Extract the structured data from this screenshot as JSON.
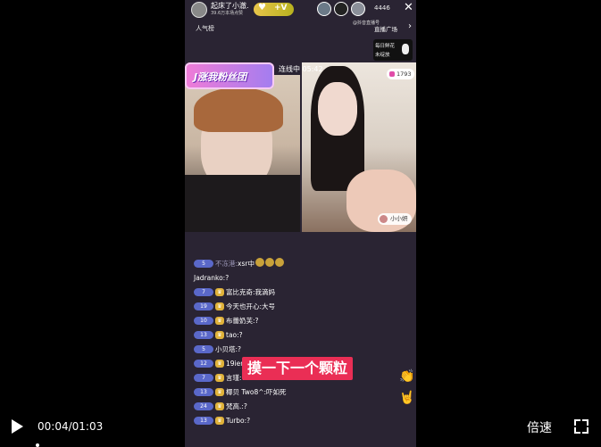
{
  "host": {
    "name": "起床了小澈.",
    "sub": "39.6万本场点赞",
    "follow_icon": "heart-icon",
    "follow_label": "+V",
    "viewer_count": "4446",
    "close_symbol": "✕"
  },
  "top": {
    "popular_label": "人气榜",
    "watermark": "@抖音直播号",
    "plaza_label": "直播广场",
    "plaza_arrow": "›",
    "gift_line1": "每日鲜花",
    "gift_line2": "未绽放"
  },
  "pk": {
    "banner_label": "J涨我粉丝团",
    "status_label": "连线中 05:42",
    "right_badge_count": "1793",
    "right_name": "小小妍"
  },
  "chat": [
    {
      "level": "5",
      "name": "不冻港:",
      "text": "xsr中",
      "muted": true,
      "emoji": 3
    },
    {
      "level": "",
      "name": "Jadranko:",
      "text": "?"
    },
    {
      "level": "7",
      "name": "富比克奇:",
      "text": "我滴妈"
    },
    {
      "level": "19",
      "name": "今天也开心:",
      "text": "大号"
    },
    {
      "level": "10",
      "name": "布蕾奶芙:",
      "text": "?"
    },
    {
      "level": "13",
      "name": "tao:",
      "text": "?"
    },
    {
      "level": "5",
      "name": "小贝塔:",
      "text": "?"
    },
    {
      "level": "12",
      "name": "19ien",
      "text": ""
    },
    {
      "level": "7",
      "name": "言瑾:",
      "text": "?"
    },
    {
      "level": "13",
      "name": "椰贝 Two8^:",
      "text": "吓如死"
    },
    {
      "level": "24",
      "name": "梵高.:",
      "text": "?"
    },
    {
      "level": "13",
      "name": "Turbo:",
      "text": "?"
    }
  ],
  "caption": "摸一下一个颗粒",
  "player": {
    "time": "00:04/01:03",
    "speed_label": "倍速",
    "progress_fraction": 0.06
  }
}
